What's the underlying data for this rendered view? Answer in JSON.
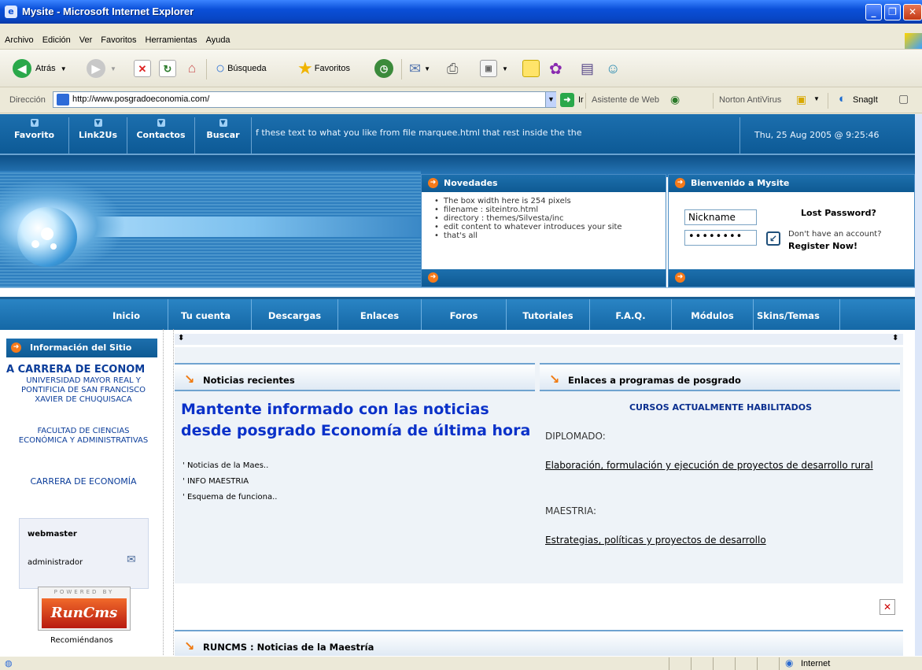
{
  "window": {
    "title": "Mysite - Microsoft Internet Explorer"
  },
  "menu": [
    "Archivo",
    "Edición",
    "Ver",
    "Favoritos",
    "Herramientas",
    "Ayuda"
  ],
  "toolbar": {
    "back": "Atrás",
    "search": "Búsqueda",
    "favorites": "Favoritos"
  },
  "address": {
    "label": "Dirección",
    "url": "http://www.posgradoeconomia.com/",
    "go": "Ir",
    "assistant": "Asistente de Web",
    "norton": "Norton AntiVirus",
    "snagit": "SnagIt"
  },
  "site": {
    "topnav": [
      "Favorito",
      "Link2Us",
      "Contactos",
      "Buscar"
    ],
    "marquee": "f these text to what you like from file marquee.html that rest inside the the",
    "datetime": "Thu, 25 Aug 2005 @ 9:25:46",
    "novedades": {
      "title": "Novedades",
      "items": [
        "The box width here is 254 pixels",
        "filename : siteintro.html",
        "directory : themes/Silvesta/inc",
        "edit content to whatever introduces your site",
        "that's all"
      ]
    },
    "welcome": {
      "title": "Bienvenido a Mysite",
      "nickname": "Nickname",
      "password": "••••••••",
      "lost": "Lost Password?",
      "noaccount": "Don't have an account?",
      "register": "Register Now!"
    },
    "mainnav": [
      "Inicio",
      "Tu cuenta",
      "Descargas",
      "Enlaces",
      "Foros",
      "Tutoriales",
      "F.A.Q.",
      "Módulos",
      "Skins/Temas"
    ],
    "sidebar": {
      "title": "Información del Sitio",
      "carrera_big": "A CARRERA DE ECONOM",
      "univ": "UNIVERSIDAD MAYOR REAL Y PONTIFICIA DE SAN FRANCISCO XAVIER DE CHUQUISACA",
      "facultad": "FACULTAD DE CIENCIAS ECONÓMICA Y ADMINISTRATIVAS",
      "carrera": "CARRERA DE ECONOMÍA",
      "user": "webmaster",
      "role": "administrador",
      "powered": "POWERED BY",
      "logo": "RunCms",
      "recommend": "Recomiéndanos"
    },
    "news": {
      "header": "Noticias recientes",
      "headline": "Mantente informado con las noticias desde posgrado Economía de última hora",
      "items": [
        "Noticias de la Maes..",
        "INFO MAESTRIA",
        "Esquema de funciona.."
      ]
    },
    "links": {
      "header": "Enlaces a programas de posgrado",
      "cursos": "CURSOS ACTUALMENTE HABILITADOS",
      "diplomado": "DIPLOMADO:",
      "dip_link": "Elaboración, formulación y ejecución de proyectos de desarrollo rural",
      "maestria": "MAESTRIA:",
      "mae_link": "Estrategias, políticas y proyectos de desarrollo"
    },
    "bottom_header": "RUNCMS : Noticias de la Maestría"
  },
  "status": {
    "zone": "Internet"
  }
}
